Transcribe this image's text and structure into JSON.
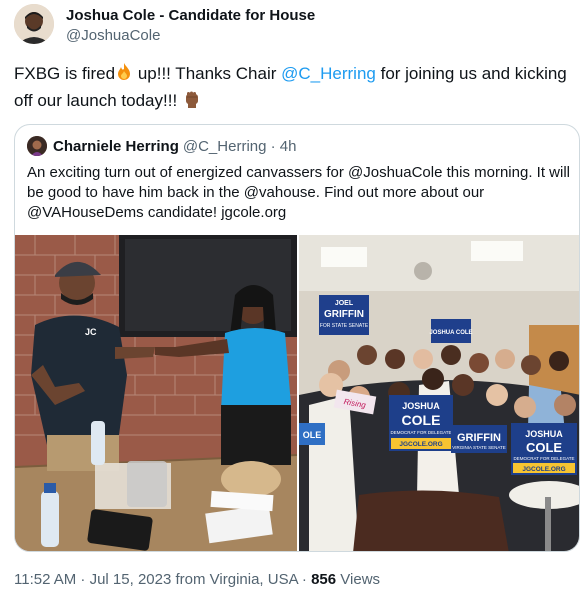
{
  "author": {
    "display_name": "Joshua Cole - Candidate for House",
    "handle": "@JoshuaCole"
  },
  "tweet": {
    "text_part1": "FXBG is fired",
    "text_part2": " up!!! Thanks Chair ",
    "mention": "@C_Herring",
    "text_part3": " for joining us and kicking off our launch today!!! "
  },
  "quote": {
    "display_name": "Charniele Herring",
    "handle_time": "@C_Herring · 4h",
    "text": "An exciting turn out of energized canvassers for @JoshuaCole this morning. It will be good to have him back in the @vahouse. Find out more about our @VAHouseDems candidate! jgcole.org"
  },
  "photo_left": {
    "shirt_logo": "JC"
  },
  "photo_right": {
    "sign_griffin_top": "JOEL",
    "sign_griffin_name": "GRIFFIN",
    "sign_griffin_sub": "FOR STATE SENATE",
    "sign_cole_first": "JOSHUA",
    "sign_cole_last": "COLE",
    "sign_cole_sub": "DEMOCRAT FOR DELEGATE",
    "sign_cole_url": "JGCOLE.ORG",
    "sign_small_cole": "JOSHUA COLE",
    "sign_pink": "Rising",
    "sign_ole": "OLE",
    "sign_griffin2": "GRIFFIN",
    "sign_griffin2_sub": "VIRGINIA STATE SENATE",
    "sign_cole2_first": "JOSHUA",
    "sign_cole2_last": "COLE",
    "sign_cole2_sub": "DEMOCRAT FOR DELEGATE",
    "sign_cole2_url": "JGCOLE.ORG"
  },
  "meta": {
    "time_date": "11:52 AM · Jul 15, 2023 from Virginia, USA · ",
    "views_count": "856",
    "views_label": " Views"
  },
  "colors": {
    "link": "#1d9bf0",
    "text": "#0f1419",
    "secondary": "#536471",
    "border": "#cfd9de"
  }
}
